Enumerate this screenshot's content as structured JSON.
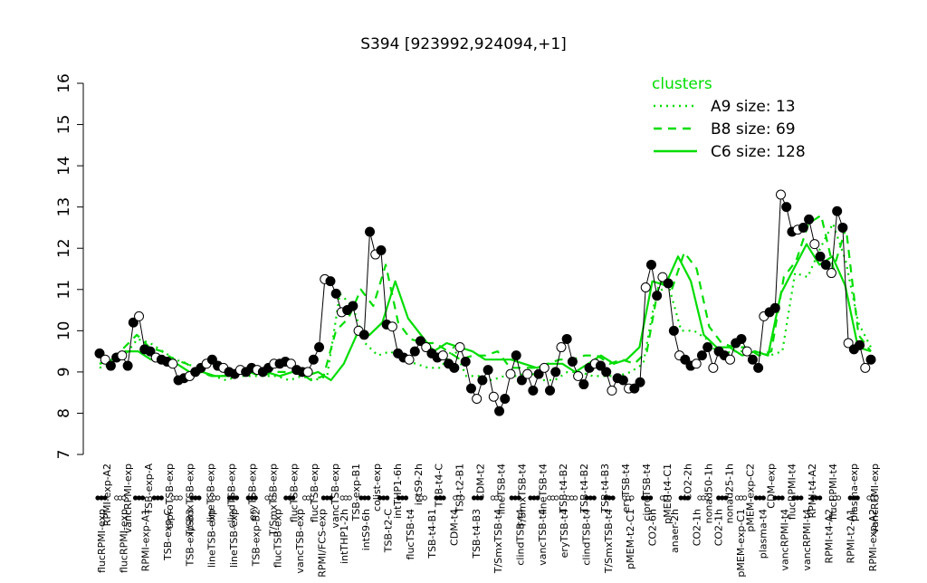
{
  "chart_data": {
    "type": "line",
    "title": "S394 [923992,924094,+1]",
    "xlabel": "",
    "ylabel": "",
    "ylim": [
      7,
      16
    ],
    "yticks": [
      "7",
      "8",
      "9",
      "10",
      "11",
      "12",
      "13",
      "14",
      "15",
      "16"
    ],
    "grid": false,
    "legend": {
      "title": "clusters",
      "placement": "top-right",
      "color": "#00dd00",
      "items": [
        {
          "label": "A9 size: 13",
          "style": "dotted"
        },
        {
          "label": "B8 size: 69",
          "style": "dashed"
        },
        {
          "label": "C6 size: 128",
          "style": "solid"
        }
      ]
    },
    "x_labels_upper": [
      "RPMI-exp-A2",
      "vancRPMI-exp",
      "TSB-exp-A",
      "ciproTSB-exp",
      "T/SmxTSB-exp",
      "lineTSB-exp",
      "clindTSB-exp",
      "eryTSB-exp",
      "T/SmxTSB-exp",
      "flucTSB-exp",
      "flucTSB-exp",
      "vancTSB-exp",
      "TSB-exp-B1",
      "colist-exp",
      "intTHP1-6h",
      "intS9-2h",
      "TSB-t4-C",
      "TSB-t2-B1",
      "CDM-t2",
      "lineTSB-t4",
      "T/SmxTSB-t4",
      "lineTSB-t4",
      "TSB-t4-B2",
      "TSB-t4-B2",
      "TSB-t4-B3",
      "eryTSB-t4",
      "ciproTSB-t4",
      "pMEM-t4-C1",
      "CO2-2h",
      "nonad50-1h",
      "nonad25-1h",
      "pMEM-exp-C2",
      "CDM-exp",
      "flucRPMI-t4",
      "RPMI-t4-A2",
      "flucRPMI-t4",
      "plasma-exp",
      "vancRPMI-exp"
    ],
    "x_labels_lower": [
      "flucRPMI-exp",
      "flucRPMI-exp",
      "RPMI-exp-A1",
      "TSB-exp-C",
      "TSB-exp-B3",
      "lineTSB-exp",
      "lineTSB-exp",
      "TSB-exp-B2",
      "flucTSB-exp",
      "vancTSB-exp",
      "RPMI/FCS-exp",
      "intTHP1-2h",
      "intS9-6h",
      "TSB-t2-C",
      "flucTSB-t4",
      "TSB-t4-B1",
      "CDM-t4",
      "TSB-t4-B3",
      "T/SmxTSB-t4",
      "clindTSB-t4",
      "vancTSB-t4",
      "eryTSB-t4",
      "clindTSB-t4",
      "T/SmxTSB-t4",
      "pMEM-t2-C1",
      "CO2-6h",
      "anaer-2h",
      "CO2-1h",
      "CO2-1h",
      "pMEM-exp-C1",
      "plasma-t4",
      "vancRPMI-t4",
      "vancRPMI-t4",
      "RPMI-t4-A2",
      "RPMI-t2-A1",
      "RPMI-exp-A2"
    ],
    "x": [
      1,
      2,
      3,
      4,
      5,
      6,
      7,
      8,
      9,
      10,
      11,
      12,
      13,
      14,
      15,
      16,
      17,
      18,
      19,
      20,
      21,
      22,
      23,
      24,
      25,
      26,
      27,
      28,
      29,
      30,
      31,
      32,
      33,
      34,
      35,
      36,
      37,
      38,
      39,
      40,
      41,
      42,
      43,
      44,
      45,
      46,
      47,
      48,
      49,
      50,
      51,
      52,
      53,
      54,
      55,
      56,
      57,
      58,
      59,
      60,
      61,
      62,
      63,
      64,
      65,
      66,
      67,
      68,
      69,
      70,
      71,
      72,
      73,
      74,
      75,
      76,
      77,
      78,
      79,
      80,
      81,
      82,
      83,
      84,
      85,
      86,
      87,
      88,
      89,
      90,
      91,
      92,
      93,
      94,
      95,
      96,
      97,
      98,
      99,
      100,
      101,
      102,
      103,
      104,
      105,
      106,
      107,
      108,
      109,
      110,
      111,
      112,
      113,
      114,
      115,
      116,
      117,
      118,
      119,
      120,
      121,
      122,
      123,
      124,
      125,
      126,
      127,
      128,
      129,
      130,
      131,
      132,
      133,
      134,
      135,
      136,
      137,
      138,
      139,
      140,
      141,
      142,
      143,
      144,
      145,
      146,
      147,
      148,
      149,
      150,
      151,
      152,
      153,
      154,
      155,
      156,
      157,
      158,
      159,
      160,
      161,
      162,
      163,
      164,
      165,
      166,
      167,
      168,
      169,
      170,
      171,
      172,
      173,
      174,
      175,
      176,
      177,
      178,
      179,
      180,
      181,
      182,
      183,
      184,
      185,
      186,
      187,
      188,
      189,
      190,
      191,
      192,
      193,
      194,
      195,
      196,
      197,
      198,
      199,
      200,
      201,
      202,
      203,
      204,
      205,
      206,
      207,
      208,
      209,
      210
    ],
    "series": [
      {
        "cluster": "A9",
        "style": "dotted",
        "values": [
          9.1,
          9.2,
          9.4,
          9.8,
          9.7,
          9.5,
          9.3,
          9.2,
          9.0,
          8.9,
          8.8,
          8.9,
          8.9,
          8.9,
          8.9,
          8.8,
          8.9,
          8.8,
          8.9,
          10.9,
          10.6,
          9.7,
          9.4,
          9.5,
          9.3,
          9.2,
          9.1,
          9.1,
          9.6,
          8.9,
          8.9,
          8.8,
          8.9,
          8.9,
          9.0,
          8.8,
          8.8,
          9.0,
          9.0,
          8.9,
          8.9,
          8.9,
          9.0,
          9.2,
          10.9,
          11.1,
          10.0,
          10.0,
          9.8,
          9.4,
          9.5,
          9.5,
          9.5,
          9.4,
          9.5,
          11.4,
          11.3,
          12.0,
          12.6,
          11.7,
          10.2,
          9.6
        ]
      },
      {
        "cluster": "B8",
        "style": "dashed",
        "values": [
          9.2,
          9.3,
          9.6,
          9.9,
          9.6,
          9.5,
          9.3,
          9.2,
          9.0,
          8.9,
          8.9,
          9.0,
          9.0,
          8.9,
          9.0,
          9.0,
          9.0,
          8.8,
          8.9,
          10.0,
          10.3,
          11.0,
          10.6,
          11.6,
          10.2,
          9.8,
          9.7,
          9.7,
          9.5,
          9.3,
          9.4,
          9.4,
          9.5,
          9.1,
          9.1,
          9.1,
          9.2,
          9.3,
          9.3,
          9.4,
          9.4,
          9.2,
          9.3,
          9.2,
          9.5,
          11.2,
          11.0,
          11.9,
          11.5,
          10.1,
          9.7,
          9.6,
          9.6,
          9.4,
          9.5,
          11.3,
          11.7,
          12.6,
          12.8,
          11.5,
          12.5,
          9.9,
          9.5
        ]
      },
      {
        "cluster": "C6",
        "style": "solid",
        "values": [
          9.2,
          9.3,
          9.5,
          9.5,
          9.3,
          9.3,
          9.2,
          9.0,
          9.0,
          8.9,
          8.9,
          9.0,
          9.0,
          9.0,
          8.9,
          9.0,
          8.9,
          9.0,
          8.8,
          9.2,
          9.9,
          9.9,
          10.2,
          11.2,
          10.3,
          9.9,
          9.5,
          9.7,
          9.6,
          9.5,
          9.3,
          9.3,
          9.3,
          9.2,
          9.1,
          9.2,
          9.2,
          9.0,
          9.2,
          9.4,
          9.2,
          9.3,
          9.6,
          11.2,
          11.1,
          11.8,
          11.2,
          9.9,
          9.6,
          9.6,
          9.4,
          9.5,
          9.4,
          10.9,
          11.5,
          12.1,
          11.6,
          11.8,
          11.1,
          9.6,
          9.5
        ]
      },
      {
        "cluster": "observations",
        "style": "black-points",
        "values": [
          9.45,
          9.3,
          9.15,
          9.35,
          9.4,
          9.15,
          10.2,
          10.35,
          9.55,
          9.5,
          9.35,
          9.3,
          9.25,
          9.2,
          8.8,
          8.85,
          8.9,
          9.0,
          9.1,
          9.2,
          9.3,
          9.15,
          9.1,
          9.0,
          8.95,
          9.05,
          9.0,
          9.1,
          9.05,
          9.0,
          9.1,
          9.2,
          9.2,
          9.25,
          9.2,
          9.05,
          9.0,
          9.0,
          9.3,
          9.6,
          11.25,
          11.2,
          10.9,
          10.45,
          10.5,
          10.6,
          10.0,
          9.9,
          12.4,
          11.85,
          11.95,
          10.15,
          10.1,
          9.45,
          9.35,
          9.3,
          9.5,
          9.75,
          9.6,
          9.45,
          9.35,
          9.4,
          9.2,
          9.1,
          9.6,
          9.25,
          8.6,
          8.35,
          8.8,
          9.05,
          8.4,
          8.05,
          8.35,
          8.95,
          9.4,
          8.8,
          8.95,
          8.55,
          8.95,
          9.1,
          8.55,
          9.0,
          9.6,
          9.8,
          9.25,
          8.9,
          8.7,
          9.1,
          9.2,
          9.15,
          9.0,
          8.55,
          8.85,
          8.8,
          8.6,
          8.6,
          8.75,
          11.05,
          11.6,
          10.85,
          11.3,
          11.15,
          10.0,
          9.4,
          9.3,
          9.15,
          9.2,
          9.4,
          9.6,
          9.1,
          9.5,
          9.4,
          9.3,
          9.7,
          9.8,
          9.5,
          9.3,
          9.1,
          10.35,
          10.45,
          10.55,
          13.3,
          13.0,
          12.4,
          12.45,
          12.5,
          12.7,
          12.1,
          11.8,
          11.6,
          11.4,
          12.9,
          12.5,
          9.7,
          9.55,
          9.65,
          9.1,
          9.3
        ]
      }
    ],
    "group_marks": [
      "filled",
      "open",
      "filled",
      "filled",
      "open",
      "filled",
      "open",
      "filled",
      "filled",
      "open",
      "filled",
      "open",
      "filled",
      "open",
      "filled",
      "filled",
      "filled",
      "open",
      "filled",
      "open",
      "filled",
      "open",
      "filled",
      "filled",
      "open",
      "open",
      "filled",
      "filled",
      "open",
      "filled",
      "open",
      "filled",
      "open",
      "filled",
      "open",
      "filled",
      "filled",
      "filled",
      "filled",
      "open",
      "filled",
      "open"
    ]
  }
}
